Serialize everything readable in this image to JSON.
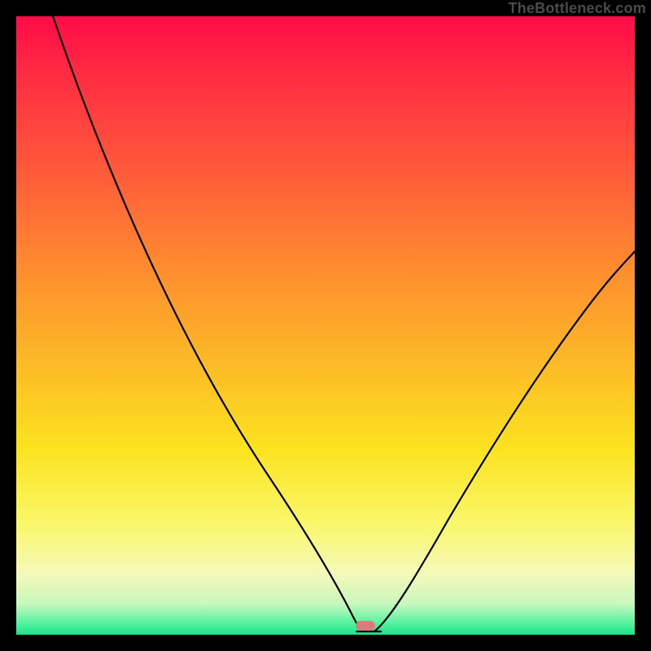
{
  "watermark": "TheBottleneck.com",
  "marker": {
    "x_frac": 0.565,
    "y_frac": 0.985,
    "color": "#d87c7c"
  },
  "chart_data": {
    "type": "line",
    "title": "",
    "xlabel": "",
    "ylabel": "",
    "xlim": [
      0,
      100
    ],
    "ylim": [
      0,
      100
    ],
    "grid": false,
    "legend": false,
    "annotations": [
      "TheBottleneck.com"
    ],
    "series": [
      {
        "name": "left-branch",
        "x": [
          6,
          12,
          18,
          24,
          30,
          36,
          42,
          47,
          51,
          54,
          56
        ],
        "y": [
          100,
          87,
          75,
          63,
          51,
          40,
          29,
          18,
          9,
          3,
          0
        ]
      },
      {
        "name": "right-branch",
        "x": [
          58,
          62,
          67,
          72,
          78,
          84,
          90,
          96,
          100
        ],
        "y": [
          0,
          6,
          13,
          21,
          30,
          39,
          48,
          56,
          62
        ]
      }
    ],
    "marker_point": {
      "x": 56.5,
      "y": 1.5
    },
    "gradient_stops": [
      {
        "pos": 0,
        "color": "#ff0b48"
      },
      {
        "pos": 25,
        "color": "#ff5a3a"
      },
      {
        "pos": 55,
        "color": "#fcb727"
      },
      {
        "pos": 82,
        "color": "#f9f76a"
      },
      {
        "pos": 95,
        "color": "#c9f7bd"
      },
      {
        "pos": 100,
        "color": "#18e38a"
      }
    ]
  }
}
